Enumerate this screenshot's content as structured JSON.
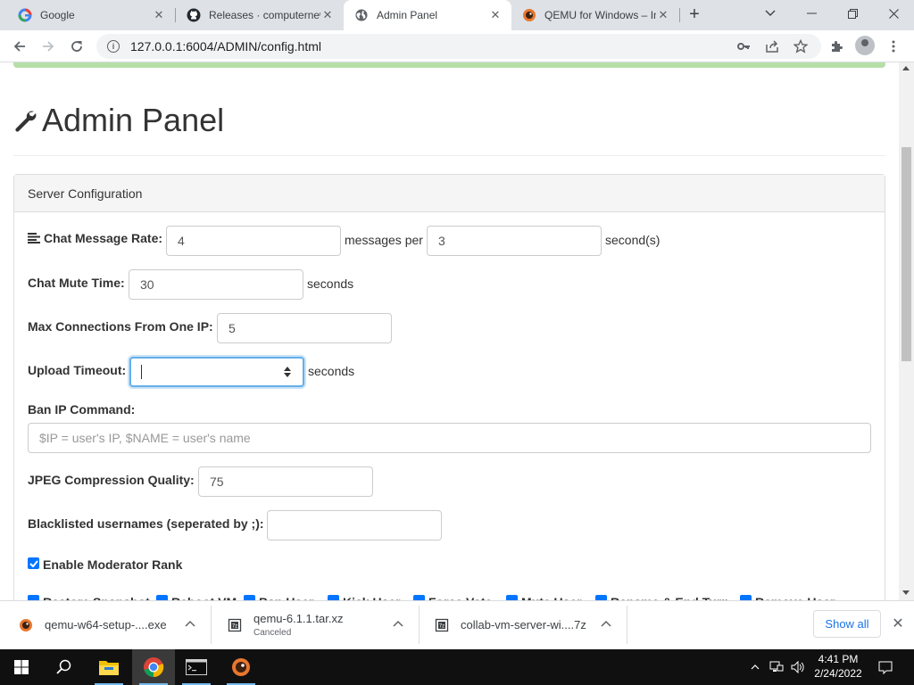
{
  "browser": {
    "tabs": [
      {
        "title": "Google",
        "icon": "google-icon"
      },
      {
        "title": "Releases · computernewb/collab",
        "icon": "github-icon"
      },
      {
        "title": "Admin Panel",
        "icon": "globe-icon"
      },
      {
        "title": "QEMU for Windows – Installers",
        "icon": "qemu-icon"
      }
    ],
    "url": "127.0.0.1:6004/ADMIN/config.html"
  },
  "page": {
    "title": "Admin Panel",
    "panel_heading": "Server Configuration",
    "fields": {
      "chat_rate": {
        "label": "Chat Message Rate:",
        "value1": "4",
        "mid": "messages per",
        "value2": "3",
        "unit": "second(s)"
      },
      "mute_time": {
        "label": "Chat Mute Time:",
        "value": "30",
        "unit": "seconds"
      },
      "max_conn": {
        "label": "Max Connections From One IP:",
        "value": "5"
      },
      "upload_timeout": {
        "label": "Upload Timeout:",
        "value": "",
        "unit": "seconds"
      },
      "ban_cmd": {
        "label": "Ban IP Command:",
        "placeholder": "$IP = user's IP, $NAME = user's name"
      },
      "jpeg": {
        "label": "JPEG Compression Quality:",
        "value": "75"
      },
      "blacklist": {
        "label": "Blacklisted usernames (seperated by ;):",
        "value": ""
      },
      "mod_rank": {
        "label": "Enable Moderator Rank",
        "checked": true
      }
    },
    "partial_row": [
      "Restore Snapshot",
      "Reboot VM",
      "Ban User",
      "Kick User",
      "Force Vote",
      "Mute User",
      "Rename & End Turn",
      "Remove User"
    ]
  },
  "downloads": [
    {
      "name": "qemu-w64-setup-....exe",
      "status": "",
      "icon": "qemu-icon"
    },
    {
      "name": "qemu-6.1.1.tar.xz",
      "status": "Canceled",
      "icon": "archive-icon"
    },
    {
      "name": "collab-vm-server-wi....7z",
      "status": "",
      "icon": "archive-icon"
    }
  ],
  "show_all": "Show all",
  "taskbar": {
    "time": "4:41 PM",
    "date": "2/24/2022"
  }
}
